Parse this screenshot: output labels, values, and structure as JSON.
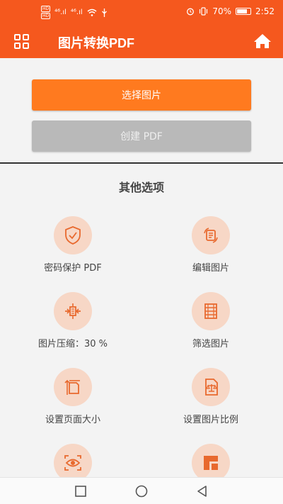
{
  "status_bar": {
    "hd1": "HD",
    "hd2": "HD",
    "signal1": "⁴⁶.ıl",
    "signal2": "⁴⁶.ıl",
    "battery_percent": "70%",
    "time": "2:52"
  },
  "app_bar": {
    "title": "图片转换PDF"
  },
  "buttons": {
    "select_images": "选择图片",
    "create_pdf": "创建 PDF"
  },
  "other_options": {
    "title": "其他选项",
    "items": [
      {
        "label": "密码保护 PDF",
        "icon": "shield-check-icon"
      },
      {
        "label": "编辑图片",
        "icon": "edit-image-icon"
      },
      {
        "label": "图片压缩：30 %",
        "icon": "compress-icon"
      },
      {
        "label": "筛选图片",
        "icon": "filter-icon"
      },
      {
        "label": "设置页面大小",
        "icon": "page-size-icon"
      },
      {
        "label": "设置图片比例",
        "icon": "image-scale-icon"
      },
      {
        "label": "",
        "icon": "eye-scan-icon"
      },
      {
        "label": "",
        "icon": "margin-icon"
      }
    ]
  },
  "colors": {
    "accent": "#f5581e",
    "button_primary": "#ff7a1f",
    "button_disabled": "#b9b9b9",
    "icon_bg": "#f7d7c6",
    "icon_fg": "#e8692e"
  }
}
